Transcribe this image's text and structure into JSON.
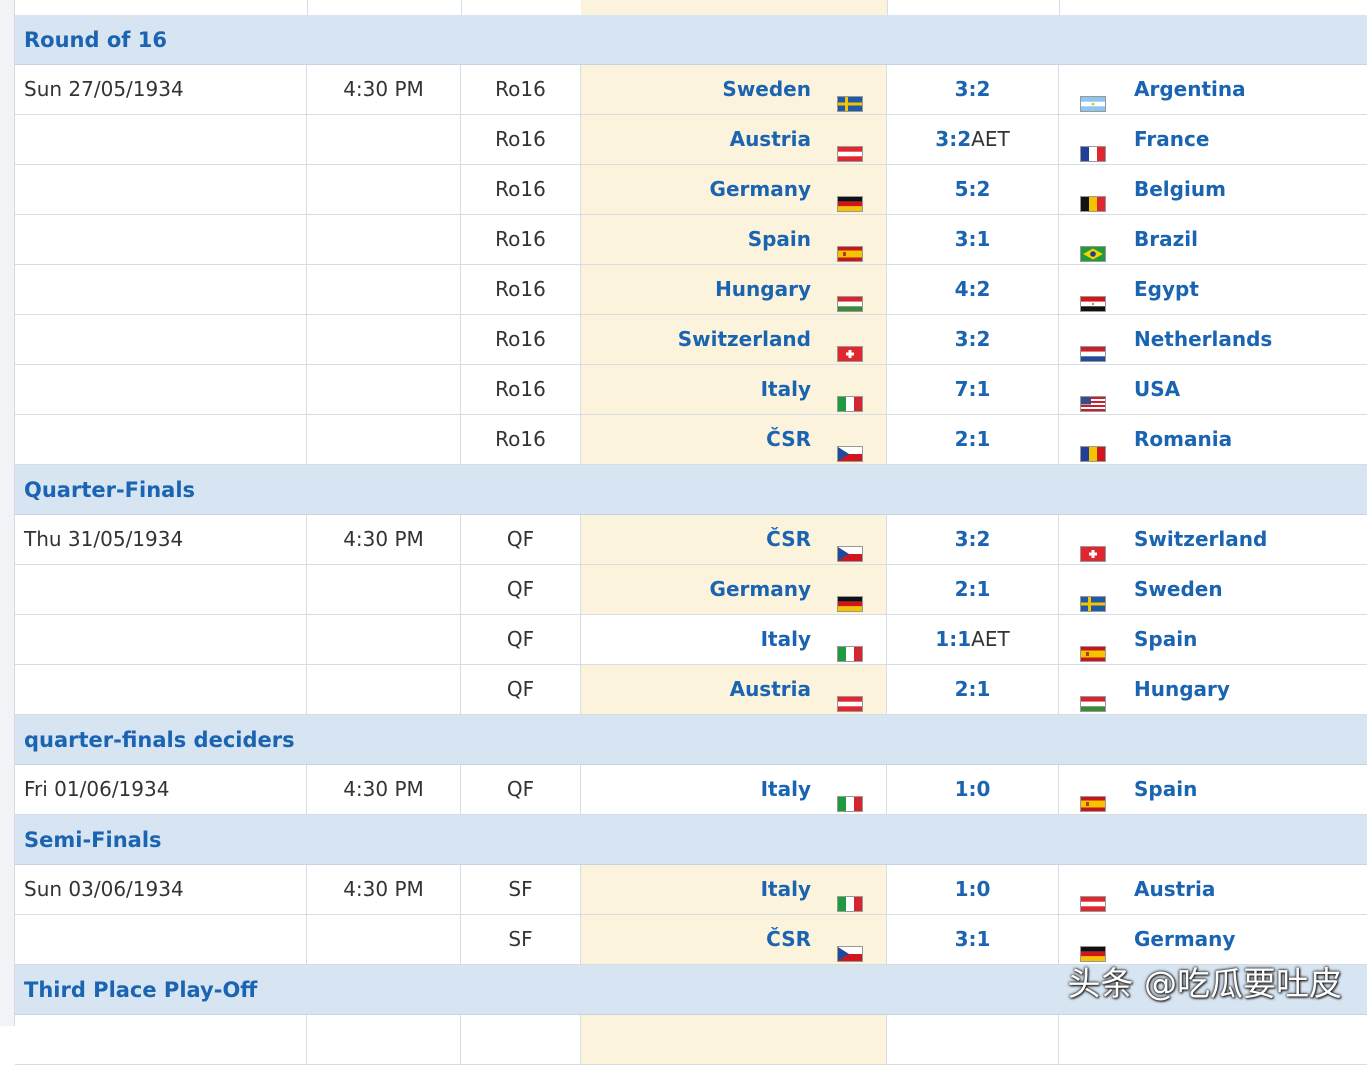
{
  "sections": [
    {
      "title": "Round of 16",
      "matches": [
        {
          "date": "Sun 27/05/1934",
          "time": "4:30 PM",
          "round": "Ro16",
          "home": "Sweden",
          "home_flag": "sweden-flag",
          "score": "3:2",
          "extra": "",
          "away": "Argentina",
          "away_flag": "argentina-flag",
          "winner": "home"
        },
        {
          "date": "",
          "time": "",
          "round": "Ro16",
          "home": "Austria",
          "home_flag": "austria-flag",
          "score": "3:2",
          "extra": "AET",
          "away": "France",
          "away_flag": "france-flag",
          "winner": "home"
        },
        {
          "date": "",
          "time": "",
          "round": "Ro16",
          "home": "Germany",
          "home_flag": "germany-flag",
          "score": "5:2",
          "extra": "",
          "away": "Belgium",
          "away_flag": "belgium-flag",
          "winner": "home"
        },
        {
          "date": "",
          "time": "",
          "round": "Ro16",
          "home": "Spain",
          "home_flag": "spain-flag",
          "score": "3:1",
          "extra": "",
          "away": "Brazil",
          "away_flag": "brazil-flag",
          "winner": "home"
        },
        {
          "date": "",
          "time": "",
          "round": "Ro16",
          "home": "Hungary",
          "home_flag": "hungary-flag",
          "score": "4:2",
          "extra": "",
          "away": "Egypt",
          "away_flag": "egypt-flag",
          "winner": "home"
        },
        {
          "date": "",
          "time": "",
          "round": "Ro16",
          "home": "Switzerland",
          "home_flag": "switzerland-flag",
          "score": "3:2",
          "extra": "",
          "away": "Netherlands",
          "away_flag": "netherlands-flag",
          "winner": "home"
        },
        {
          "date": "",
          "time": "",
          "round": "Ro16",
          "home": "Italy",
          "home_flag": "italy-flag",
          "score": "7:1",
          "extra": "",
          "away": "USA",
          "away_flag": "usa-flag",
          "winner": "home"
        },
        {
          "date": "",
          "time": "",
          "round": "Ro16",
          "home": "ČSR",
          "home_flag": "czechoslovakia-flag",
          "score": "2:1",
          "extra": "",
          "away": "Romania",
          "away_flag": "romania-flag",
          "winner": "home"
        }
      ]
    },
    {
      "title": "Quarter-Finals",
      "matches": [
        {
          "date": "Thu 31/05/1934",
          "time": "4:30 PM",
          "round": "QF",
          "home": "ČSR",
          "home_flag": "czechoslovakia-flag",
          "score": "3:2",
          "extra": "",
          "away": "Switzerland",
          "away_flag": "switzerland-flag",
          "winner": "home"
        },
        {
          "date": "",
          "time": "",
          "round": "QF",
          "home": "Germany",
          "home_flag": "germany-flag",
          "score": "2:1",
          "extra": "",
          "away": "Sweden",
          "away_flag": "sweden-flag",
          "winner": "home"
        },
        {
          "date": "",
          "time": "",
          "round": "QF",
          "home": "Italy",
          "home_flag": "italy-flag",
          "score": "1:1",
          "extra": "AET",
          "away": "Spain",
          "away_flag": "spain-flag",
          "winner": "none"
        },
        {
          "date": "",
          "time": "",
          "round": "QF",
          "home": "Austria",
          "home_flag": "austria-flag",
          "score": "2:1",
          "extra": "",
          "away": "Hungary",
          "away_flag": "hungary-flag",
          "winner": "home"
        }
      ]
    },
    {
      "title": "quarter-finals deciders",
      "matches": [
        {
          "date": "Fri 01/06/1934",
          "time": "4:30 PM",
          "round": "QF",
          "home": "Italy",
          "home_flag": "italy-flag",
          "score": "1:0",
          "extra": "",
          "away": "Spain",
          "away_flag": "spain-flag",
          "winner": "none"
        }
      ]
    },
    {
      "title": "Semi-Finals",
      "matches": [
        {
          "date": "Sun 03/06/1934",
          "time": "4:30 PM",
          "round": "SF",
          "home": "Italy",
          "home_flag": "italy-flag",
          "score": "1:0",
          "extra": "",
          "away": "Austria",
          "away_flag": "austria-flag",
          "winner": "home"
        },
        {
          "date": "",
          "time": "",
          "round": "SF",
          "home": "ČSR",
          "home_flag": "czechoslovakia-flag",
          "score": "3:1",
          "extra": "",
          "away": "Germany",
          "away_flag": "germany-flag",
          "winner": "home"
        }
      ]
    },
    {
      "title": "Third Place Play-Off",
      "matches": []
    }
  ],
  "watermark": "头条 @吃瓜要吐皮",
  "colors": {
    "section_bg": "#d7e4f1",
    "link_blue": "#1a64b1",
    "winner_bg": "#fcf3dd",
    "row_border": "#d8dde3"
  }
}
